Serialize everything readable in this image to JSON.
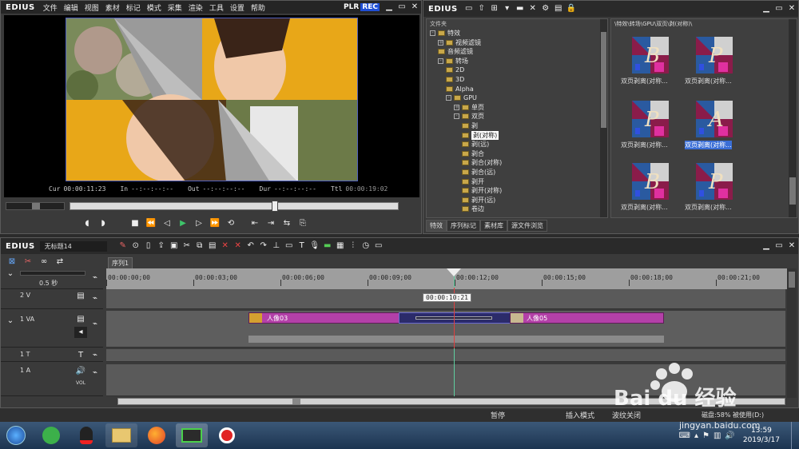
{
  "player": {
    "logo": "EDIUS",
    "menu": [
      "文件",
      "编辑",
      "视图",
      "素材",
      "标记",
      "模式",
      "采集",
      "渲染",
      "工具",
      "设置",
      "帮助"
    ],
    "plr": "PLR",
    "rec": "REC",
    "cur_label": "Cur",
    "cur_value": "00:00:11:23",
    "in_label": "In",
    "in_value": "--:--:--:--",
    "out_label": "Out",
    "out_value": "--:--:--:--",
    "dur_label": "Dur",
    "dur_value": "--:--:--:--",
    "ttl_label": "Ttl",
    "ttl_value": "00:00:19:02"
  },
  "library": {
    "logo": "EDIUS",
    "folder_header": "文件夹",
    "path": "\\特效\\转场\\GPU\\双页\\剥(对称)\\",
    "tree": [
      {
        "label": "特效",
        "indent": 0,
        "box": "-"
      },
      {
        "label": "视频滤镜",
        "indent": 1,
        "box": "+"
      },
      {
        "label": "音频滤镜",
        "indent": 1,
        "box": ""
      },
      {
        "label": "转场",
        "indent": 1,
        "box": "-"
      },
      {
        "label": "2D",
        "indent": 2,
        "box": ""
      },
      {
        "label": "3D",
        "indent": 2,
        "box": ""
      },
      {
        "label": "Alpha",
        "indent": 2,
        "box": ""
      },
      {
        "label": "GPU",
        "indent": 2,
        "box": "-"
      },
      {
        "label": "单页",
        "indent": 3,
        "box": "+"
      },
      {
        "label": "双页",
        "indent": 3,
        "box": "-"
      },
      {
        "label": "剥",
        "indent": 4,
        "box": ""
      },
      {
        "label": "剥(对称)",
        "indent": 4,
        "box": "",
        "selected": true
      },
      {
        "label": "剥(远)",
        "indent": 4,
        "box": ""
      },
      {
        "label": "剥合",
        "indent": 4,
        "box": ""
      },
      {
        "label": "剥合(对称)",
        "indent": 4,
        "box": ""
      },
      {
        "label": "剥合(远)",
        "indent": 4,
        "box": ""
      },
      {
        "label": "剥开",
        "indent": 4,
        "box": ""
      },
      {
        "label": "剥开(对称)",
        "indent": 4,
        "box": ""
      },
      {
        "label": "剥开(远)",
        "indent": 4,
        "box": ""
      },
      {
        "label": "卷边",
        "indent": 4,
        "box": ""
      }
    ],
    "thumbs": [
      {
        "label": "双页剥离(对称...",
        "letter": "B"
      },
      {
        "label": "双页剥离(对称...",
        "letter": "P"
      },
      {
        "label": "双页剥离(对称...",
        "letter": "P"
      },
      {
        "label": "双页剥离(对称...",
        "letter": "A",
        "selected": true
      },
      {
        "label": "双页剥离(对称...",
        "letter": "B"
      },
      {
        "label": "双页剥离(对称...",
        "letter": "P"
      }
    ],
    "tabs": [
      "特效",
      "序列标记",
      "素材库",
      "源文件浏览"
    ]
  },
  "timeline": {
    "logo": "EDIUS",
    "project": "无标题14",
    "sequence_tab": "序列1",
    "zoom": "0.5 秒",
    "ruler": [
      "00:00:00;00",
      "00:00:03;00",
      "00:00:06;00",
      "00:00:09;00",
      "00:00:12;00",
      "00:00:15;00",
      "00:00:18;00",
      "00:00:21;00"
    ],
    "playhead_tooltip": "00:00:10:21",
    "tracks": {
      "v2": "2 V",
      "va1": "1 VA",
      "t1": "1 T",
      "a1": "1 A",
      "vol": "VOL"
    },
    "clips": {
      "clip1": "人像03",
      "clip2": "人像05"
    }
  },
  "status": {
    "pause": "暂停",
    "insert": "插入模式",
    "ripple": "波纹关闭",
    "disk": "磁盘:58% 被使用(D:)"
  },
  "taskbar": {
    "time": "13:59",
    "date": "2019/3/17"
  },
  "watermark": {
    "text": "Bai du 经验",
    "url": "jingyan.baidu.com"
  },
  "colors": {
    "clip_magenta": "#b340a8",
    "rec_blue": "#1f4fd6",
    "accent_green": "#3ec46a",
    "playhead": "#e04040",
    "selected_blue": "#3a6ed6"
  }
}
